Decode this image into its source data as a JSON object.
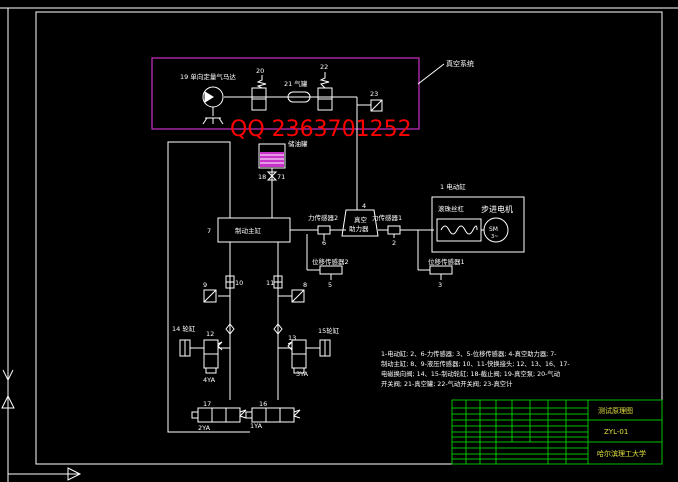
{
  "watermark": "QQ 2363701252",
  "vacuum_system_label": "真空系统",
  "components": {
    "air_motor": "19 单向定量气马达",
    "c20": "20",
    "c21": "21 气罐",
    "c22": "22",
    "c23": "23",
    "oil_tank": "储油罐",
    "c18_num": "18",
    "c18_suffix": "71",
    "brake_master": "制动主缸",
    "c7": "7",
    "force_sensor2": "力传感器2",
    "c6": "6",
    "vacuum_booster": "真空\n助力器",
    "c4": "4",
    "force_sensor1": "力传感器1",
    "c2": "2",
    "disp_sensor2": "位移传感器2",
    "c5": "5",
    "disp_sensor1": "位移传感器1",
    "c3": "3",
    "c1_cylinder": "1 电动缸",
    "ball_screw": "滚珠丝杠",
    "stepper_motor": "步进电机",
    "sm_symbol": "SM\n3~",
    "c9": "9",
    "c10": "10",
    "c11": "11",
    "c8": "8",
    "c14": "14 轮缸",
    "c15": "15轮缸",
    "c12": "12",
    "c13": "13",
    "ya4": "4YA",
    "ya3": "3YA",
    "c17": "17",
    "c16": "16",
    "ya2": "2YA",
    "ya1": "1YA"
  },
  "legend_lines": [
    "1-电动缸; 2、6-力传感器; 3、5-位移传感器; 4-真空助力器; 7-",
    "制动主缸; 8、9-液压传感器; 10、11-快换接头; 12、13、16、17-",
    "电磁换向阀; 14、15-制动轮缸; 18-截止阀; 19-真空泵; 20-气动",
    "开关阀; 21-真空罐; 22-气动开关阀; 23-真空计"
  ],
  "title_block": {
    "title": "测试原理图",
    "drawing_no": "ZYL-01",
    "school": "哈尔滨理工大学"
  },
  "colors": {
    "background": "#000000",
    "line": "#ffffff",
    "vacuum_box": "#c832c8",
    "watermark": "#ff0000",
    "title_block": "#00c000",
    "title_text": "#e0e040",
    "frame": "#ffffff"
  }
}
